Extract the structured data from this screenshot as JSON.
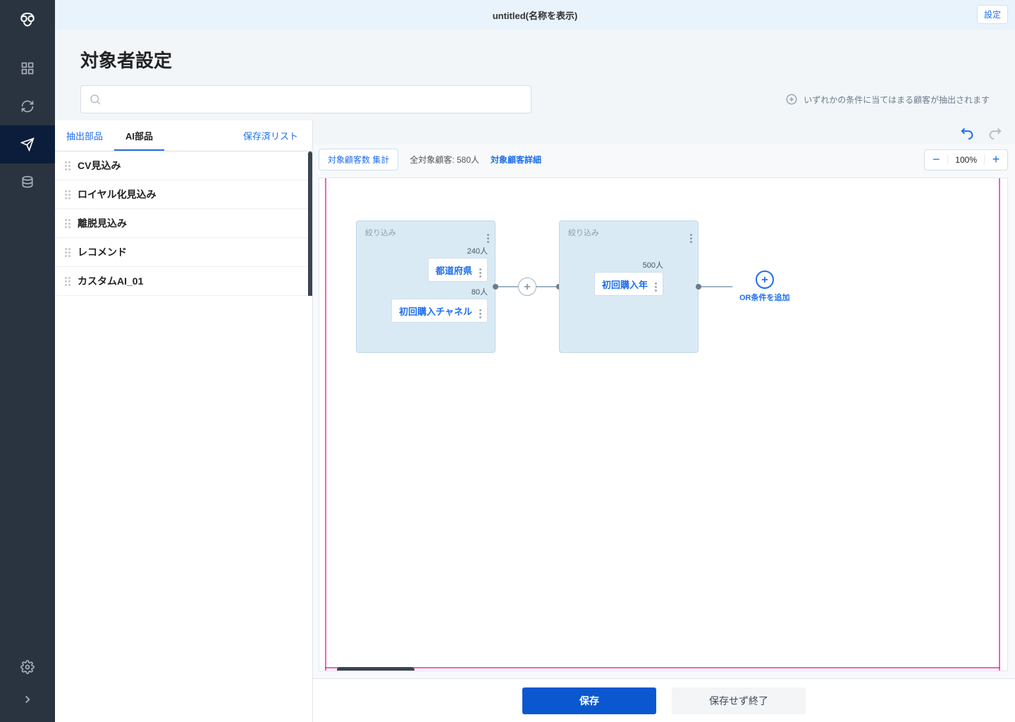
{
  "header": {
    "title": "untitled(名称を表示)",
    "settings_label": "設定"
  },
  "page": {
    "title": "対象者設定",
    "search_placeholder": "",
    "hint_text": "いずれかの条件に当てはまる顧客が抽出されます"
  },
  "tabs": {
    "extract": "抽出部品",
    "ai": "AI部品",
    "saved": "保存済リスト"
  },
  "ai_list": {
    "items": [
      {
        "label": "CV見込み"
      },
      {
        "label": "ロイヤル化見込み"
      },
      {
        "label": "離脱見込み"
      },
      {
        "label": "レコメンド"
      },
      {
        "label": "カスタムAI_01"
      }
    ]
  },
  "summary": {
    "aggregate_btn": "対象顧客数 集計",
    "total_label": "全対象顧客: 580人",
    "detail_link": "対象顧客詳細"
  },
  "zoom": {
    "value": "100%"
  },
  "canvas": {
    "block1": {
      "header": "絞り込み",
      "chip1_count": "240人",
      "chip1_label": "都道府県",
      "chip2_count": "80人",
      "chip2_label": "初回購入チャネル"
    },
    "block2": {
      "header": "絞り込み",
      "chip1_count": "500人",
      "chip1_label": "初回購入年"
    },
    "add_or_label": "OR条件を追加"
  },
  "footer": {
    "save": "保存",
    "discard": "保存せず終了"
  }
}
